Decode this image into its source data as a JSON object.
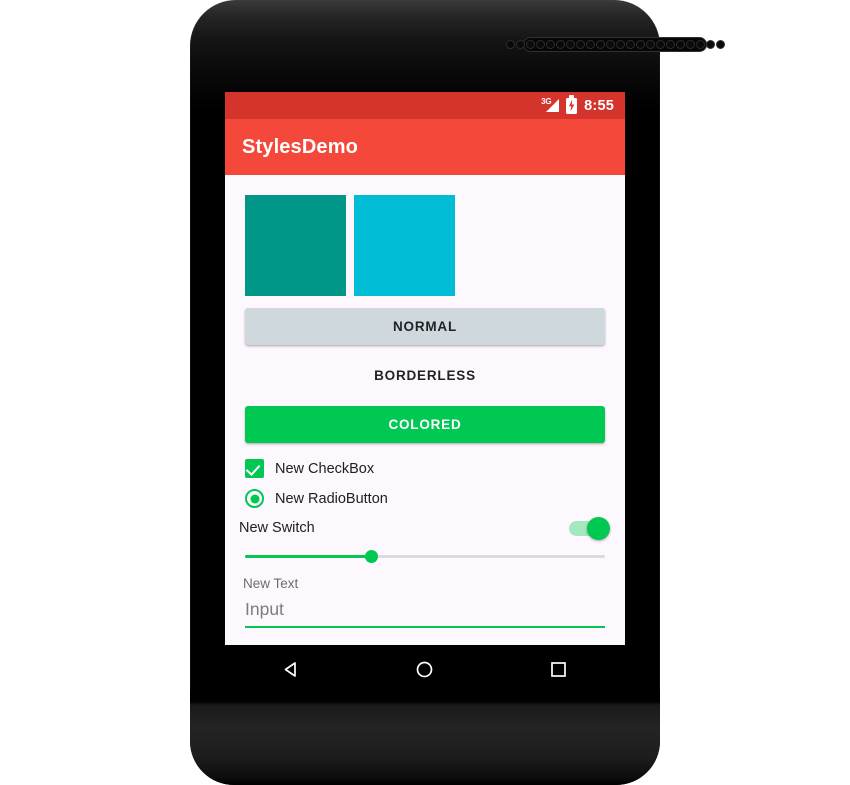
{
  "device": {
    "earpiece_holes": 22
  },
  "status_bar": {
    "background": "#D4342C",
    "network_label": "3G",
    "signal_icon": "signal-triangle-icon",
    "battery_icon": "battery-charging-icon",
    "time": "8:55"
  },
  "app_bar": {
    "background": "#F4483A",
    "title": "StylesDemo"
  },
  "screen": {
    "background": "#FDF8FD"
  },
  "swatches": [
    {
      "name": "teal-swatch",
      "color": "#009688"
    },
    {
      "name": "cyan-swatch",
      "color": "#00BCD4"
    }
  ],
  "buttons": {
    "normal": {
      "label": "NORMAL",
      "background": "#CFD8DC",
      "text_color": "#1f2326"
    },
    "borderless": {
      "label": "BORDERLESS",
      "background": "transparent",
      "text_color": "#1f2326"
    },
    "colored": {
      "label": "COLORED",
      "background": "#00C853",
      "text_color": "#FFFFFF"
    }
  },
  "controls": {
    "checkbox": {
      "label": "New CheckBox",
      "checked": true,
      "color": "#00C853"
    },
    "radio": {
      "label": "New RadioButton",
      "selected": true,
      "color": "#00C853"
    },
    "switch": {
      "label": "New Switch",
      "on": true,
      "thumb_color": "#00C853",
      "track_color": "#A5E8BE"
    },
    "seekbar": {
      "value_percent": 35,
      "fill_color": "#00C853",
      "track_color": "#DCDCDC"
    },
    "text_label": "New Text",
    "input": {
      "placeholder": "Input",
      "value": "",
      "underline_color": "#00C853"
    }
  },
  "nav_bar": {
    "background": "#000000",
    "back_label": "back-icon",
    "home_label": "home-icon",
    "recents_label": "recents-icon"
  }
}
